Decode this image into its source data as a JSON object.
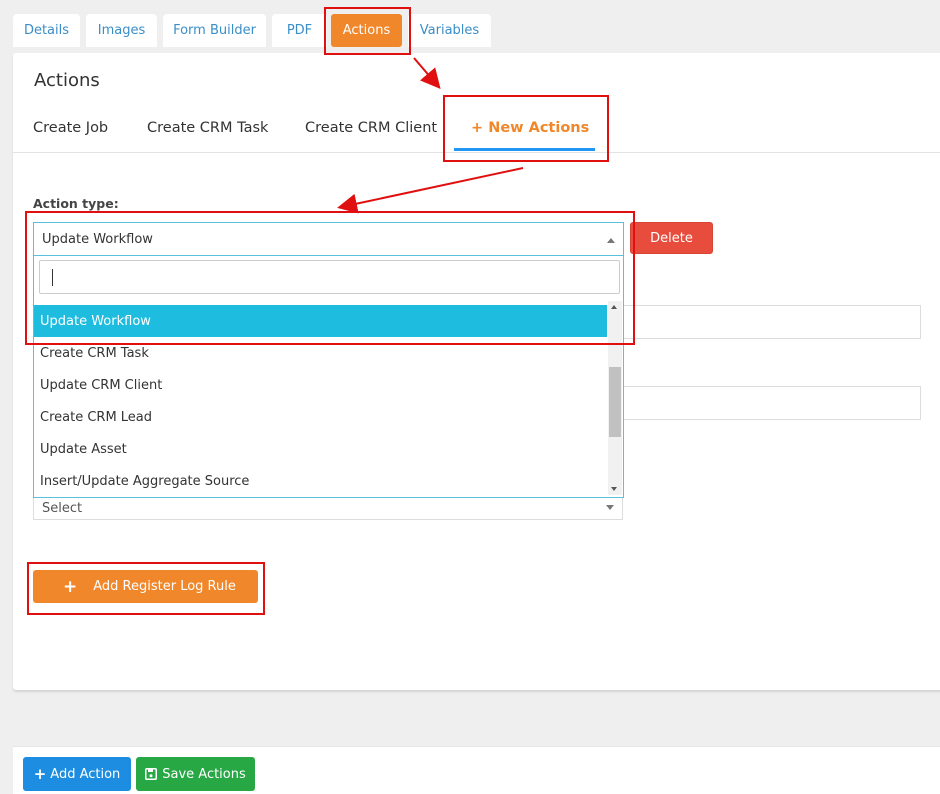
{
  "top_tabs": [
    {
      "label": "Details"
    },
    {
      "label": "Images"
    },
    {
      "label": "Form Builder"
    },
    {
      "label": "PDF"
    },
    {
      "label": "Actions",
      "active": true
    },
    {
      "label": "Variables"
    }
  ],
  "panel": {
    "title": "Actions",
    "sub_tabs": [
      {
        "label": "Create Job"
      },
      {
        "label": "Create CRM Task"
      },
      {
        "label": "Create CRM Client"
      },
      {
        "label": "+ New Actions",
        "active": true
      }
    ]
  },
  "action_type": {
    "label": "Action type:",
    "selected": "Update Workflow",
    "delete_label": "Delete",
    "search_value": "",
    "options": [
      {
        "label": "Update Workflow",
        "highlighted": true
      },
      {
        "label": "Create CRM Task"
      },
      {
        "label": "Update CRM Client"
      },
      {
        "label": "Create CRM Lead"
      },
      {
        "label": "Update Asset"
      },
      {
        "label": "Insert/Update Aggregate Source"
      }
    ]
  },
  "second_select": {
    "value": "Select"
  },
  "register_button": {
    "icon": "plus-icon",
    "label": "Add Register Log Rule"
  },
  "footer": {
    "add_action": {
      "icon": "plus-icon",
      "label": "Add Action"
    },
    "save_actions": {
      "icon": "floppy-disk-icon",
      "label": "Save Actions"
    }
  },
  "colors": {
    "accent_orange": "#f0872b",
    "link_blue": "#3a8ec8",
    "highlight_cyan": "#1ebde0",
    "delete_red": "#e74c3c",
    "primary_blue": "#1c8de0",
    "success_green": "#28a745",
    "annotation_red": "#e01010"
  }
}
